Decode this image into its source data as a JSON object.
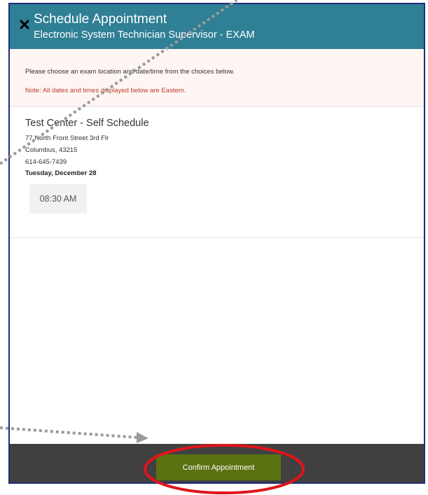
{
  "dialog": {
    "title": "Schedule Appointment",
    "subtitle": "Electronic System Technician Supervisor - EXAM",
    "close_icon": "close-x-icon"
  },
  "notice": {
    "instruction": "Please choose an exam location and date/time from the choices below.",
    "note": "Note: All dates and times displayed below are Eastern."
  },
  "location": {
    "name": "Test Center - Self Schedule",
    "street": "77 North Front Street 3rd Flr",
    "city_zip": "Columbus,  43215",
    "phone": "614-645-7439",
    "date": "Tuesday, December 28",
    "time_slots": [
      "08:30 AM"
    ]
  },
  "footer": {
    "confirm_label": "Confirm Appointment"
  },
  "colors": {
    "header_bg": "#2f7f95",
    "note_text": "#c0392b",
    "confirm_bg": "#5b7212",
    "footer_bg": "#404040",
    "annotation_circle": "#e0141b",
    "annotation_dots": "#9a9a9a"
  }
}
